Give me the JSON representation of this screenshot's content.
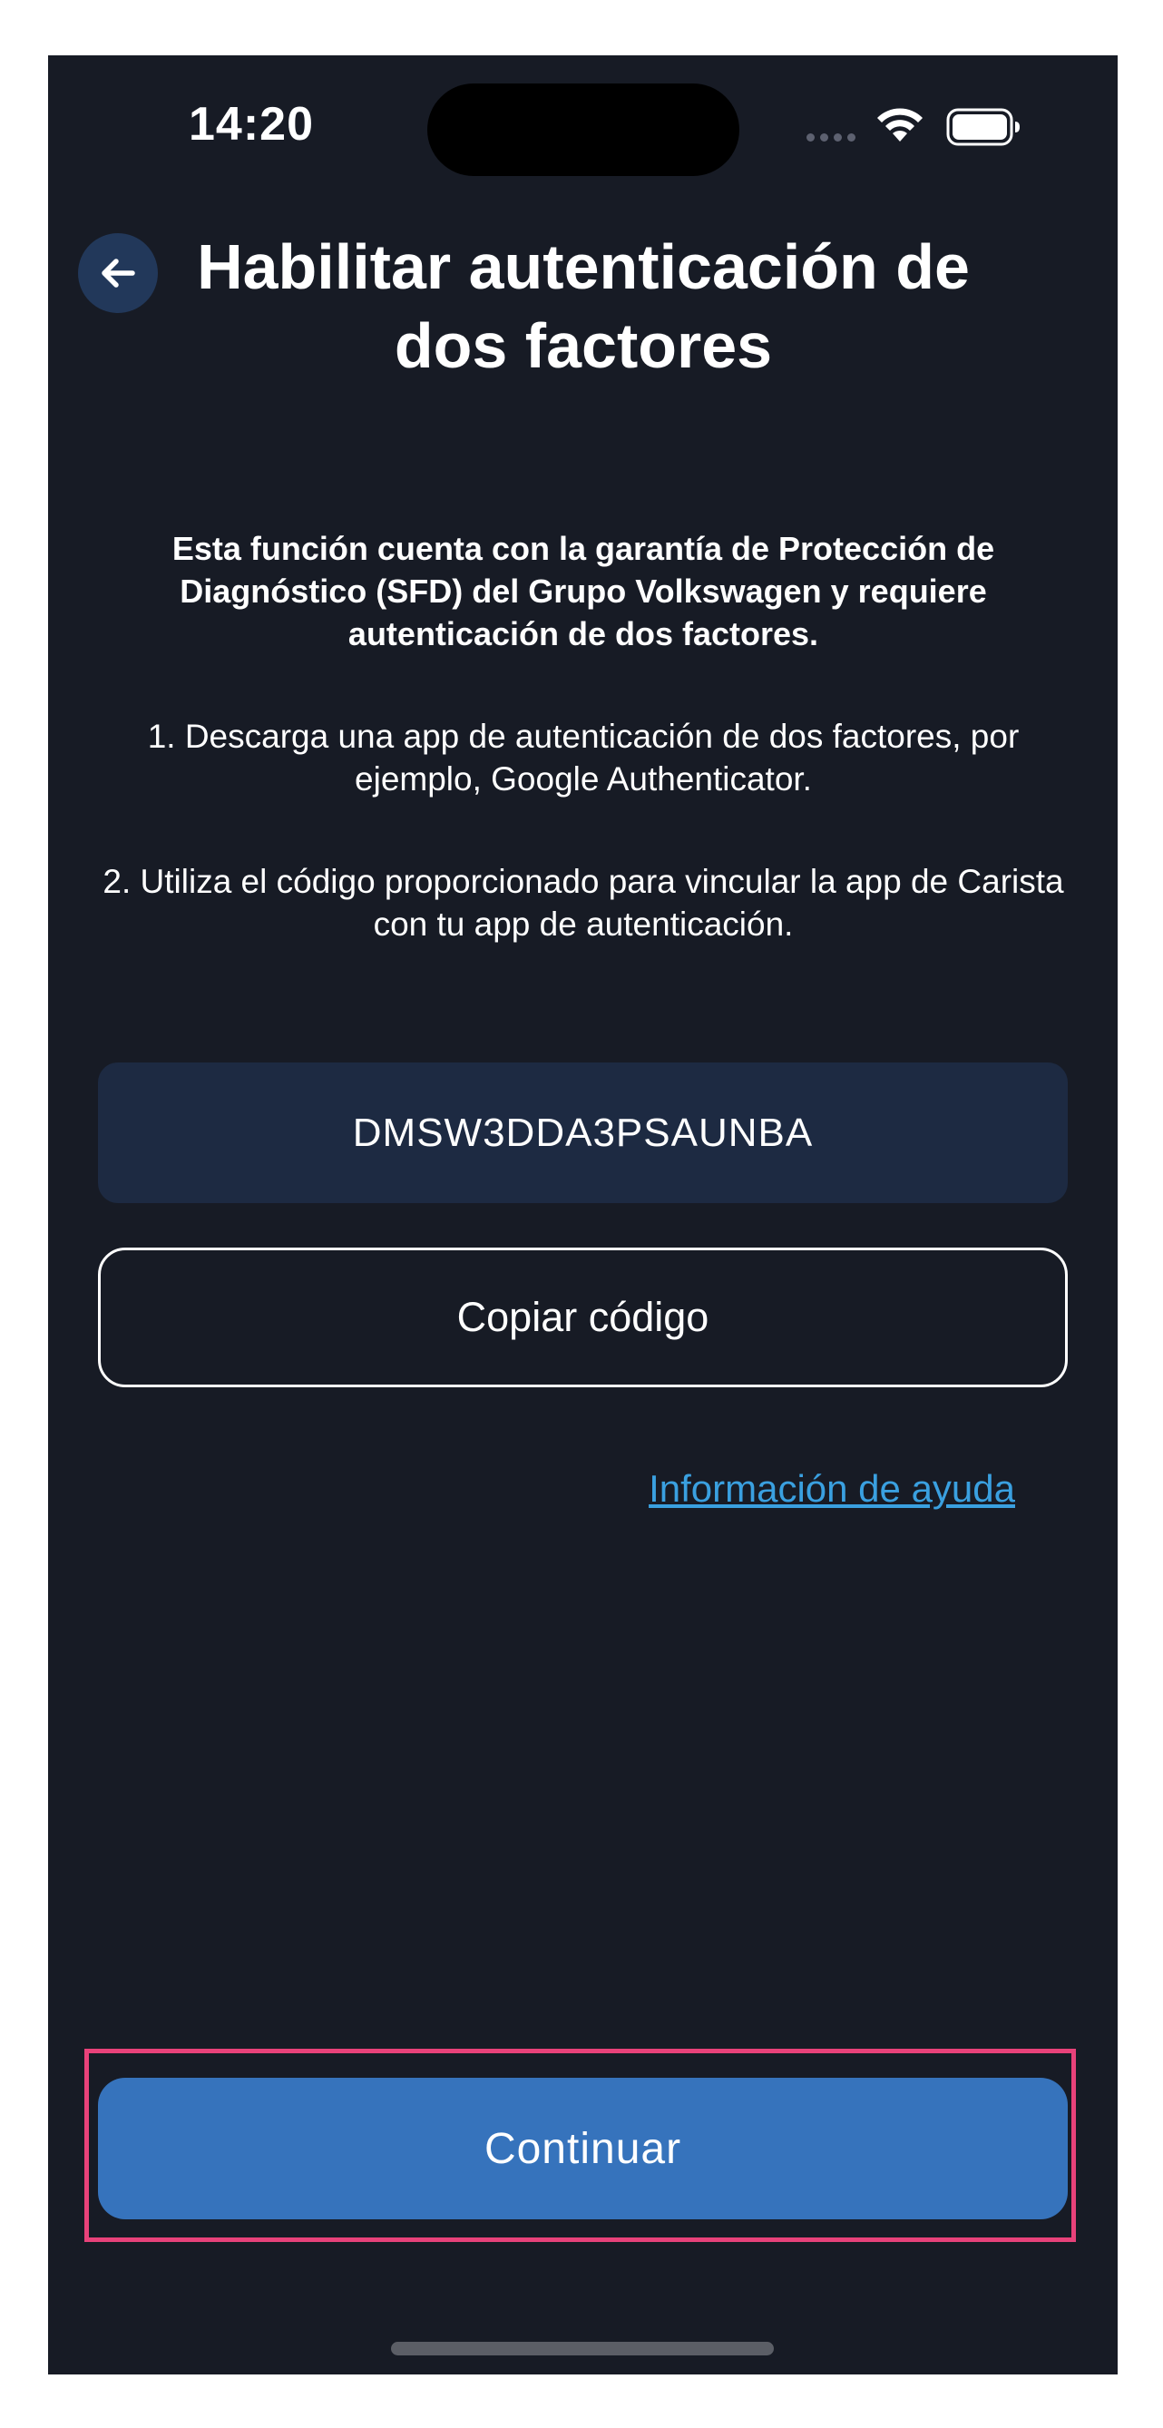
{
  "status_bar": {
    "time": "14:20",
    "icons": [
      "cellular-signal-icon",
      "wifi-icon",
      "battery-icon"
    ]
  },
  "header": {
    "back_icon": "arrow-left-icon",
    "title": "Habilitar autenticación de dos factores"
  },
  "body": {
    "intro": "Esta función cuenta con la garantía de Protección de Diagnóstico (SFD) del Grupo Volkswagen y requiere autenticación de dos factores.",
    "step1": "1. Descarga una app de autenticación de dos factores, por ejemplo, Google Authenticator.",
    "step2": "2. Utiliza el código proporcionado para vincular la app de Carista con tu app de autenticación."
  },
  "code": {
    "value": "DMSW3DDA3PSAUNBA"
  },
  "actions": {
    "copy_label": "Copiar código",
    "help_link": "Información de ayuda",
    "continue_label": "Continuar"
  },
  "colors": {
    "background": "#171b25",
    "code_box": "#1d2a42",
    "primary_button": "#3673bc",
    "link": "#3aa0e0",
    "highlight": "#e8427a"
  }
}
